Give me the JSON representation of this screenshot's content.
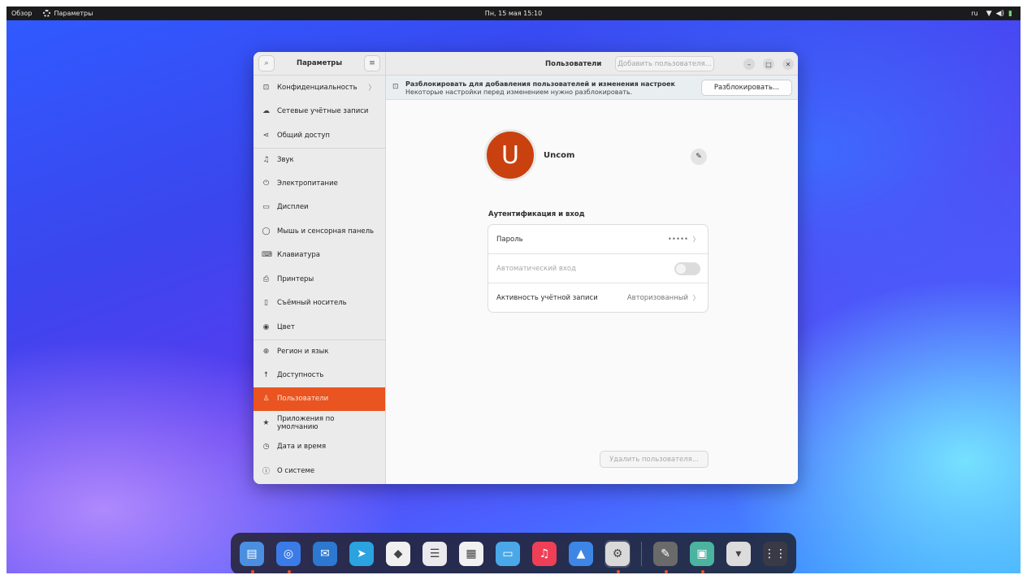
{
  "topbar": {
    "activities": "Обзор",
    "app_name": "Параметры",
    "clock": "Пн, 15 мая 15:10",
    "language": "ru",
    "tray_icons": [
      "wifi-icon",
      "volume-icon",
      "battery-icon"
    ]
  },
  "sidebar": {
    "title": "Параметры",
    "items": [
      {
        "label": "Конфиденциальность",
        "icon": "lock-icon",
        "has_chevron": true
      },
      {
        "label": "Сетевые учётные записи",
        "icon": "cloud-icon"
      },
      {
        "label": "Общий доступ",
        "icon": "share-icon"
      },
      {
        "label": "Звук",
        "icon": "music-note-icon"
      },
      {
        "label": "Электропитание",
        "icon": "power-icon"
      },
      {
        "label": "Дисплеи",
        "icon": "display-icon"
      },
      {
        "label": "Мышь и сенсорная панель",
        "icon": "mouse-icon"
      },
      {
        "label": "Клавиатура",
        "icon": "keyboard-icon"
      },
      {
        "label": "Принтеры",
        "icon": "printer-icon"
      },
      {
        "label": "Съёмный носитель",
        "icon": "removable-media-icon"
      },
      {
        "label": "Цвет",
        "icon": "color-icon"
      },
      {
        "label": "Регион и язык",
        "icon": "globe-icon"
      },
      {
        "label": "Доступность",
        "icon": "accessibility-icon"
      },
      {
        "label": "Пользователи",
        "icon": "user-icon",
        "active": true
      },
      {
        "label": "Приложения по умолчанию",
        "icon": "star-icon"
      },
      {
        "label": "Дата и время",
        "icon": "clock-icon"
      },
      {
        "label": "О системе",
        "icon": "info-icon"
      }
    ]
  },
  "header": {
    "title": "Пользователи",
    "add_user_placeholder": "Добавить пользователя..."
  },
  "banner": {
    "title": "Разблокировать для добавления пользователей и изменения настроек",
    "subtitle": "Некоторые настройки перед изменением нужно разблокировать.",
    "unlock_label": "Разблокировать..."
  },
  "user": {
    "initial": "U",
    "name": "Uncom",
    "avatar_color": "#c9410f"
  },
  "auth": {
    "section_title": "Аутентификация и вход",
    "password_label": "Пароль",
    "password_value": "•••••",
    "autologin_label": "Автоматический вход",
    "autologin_enabled": false,
    "activity_label": "Активность учётной записи",
    "activity_value": "Авторизованный"
  },
  "delete_user_label": "Удалить пользователя...",
  "dock": {
    "items": [
      {
        "name": "files",
        "color": "#4a8fe0",
        "glyph": "▤",
        "running": true
      },
      {
        "name": "chromium",
        "color": "#3b7be8",
        "glyph": "◎",
        "running": true
      },
      {
        "name": "mail",
        "color": "#2d78d0",
        "glyph": "✉"
      },
      {
        "name": "telegram",
        "color": "#2aa3e0",
        "glyph": "➤"
      },
      {
        "name": "office",
        "color": "#f0f0f0",
        "glyph": "◆"
      },
      {
        "name": "notes",
        "color": "#e9e9ee",
        "glyph": "☰"
      },
      {
        "name": "calendar",
        "color": "#f1f1f1",
        "glyph": "▦"
      },
      {
        "name": "screenshot",
        "color": "#4aa8e8",
        "glyph": "▭"
      },
      {
        "name": "music",
        "color": "#ee3f56",
        "glyph": "♫"
      },
      {
        "name": "software",
        "color": "#3e86e6",
        "glyph": "▲"
      },
      {
        "name": "settings",
        "color": "#d9d9d9",
        "glyph": "⚙",
        "running": true,
        "selected": true
      },
      {
        "name": "cleaner",
        "color": "#6a6a6a",
        "glyph": "✎",
        "running": true
      },
      {
        "name": "image-viewer",
        "color": "#4bb3a0",
        "glyph": "▣",
        "running": true
      },
      {
        "name": "trash",
        "color": "#dcdcdc",
        "glyph": "▾"
      },
      {
        "name": "app-grid",
        "color": "#3a3a46",
        "glyph": "⋮⋮"
      }
    ]
  },
  "colors": {
    "accent": "#e95420",
    "topbar_bg": "#1b1b1d"
  }
}
